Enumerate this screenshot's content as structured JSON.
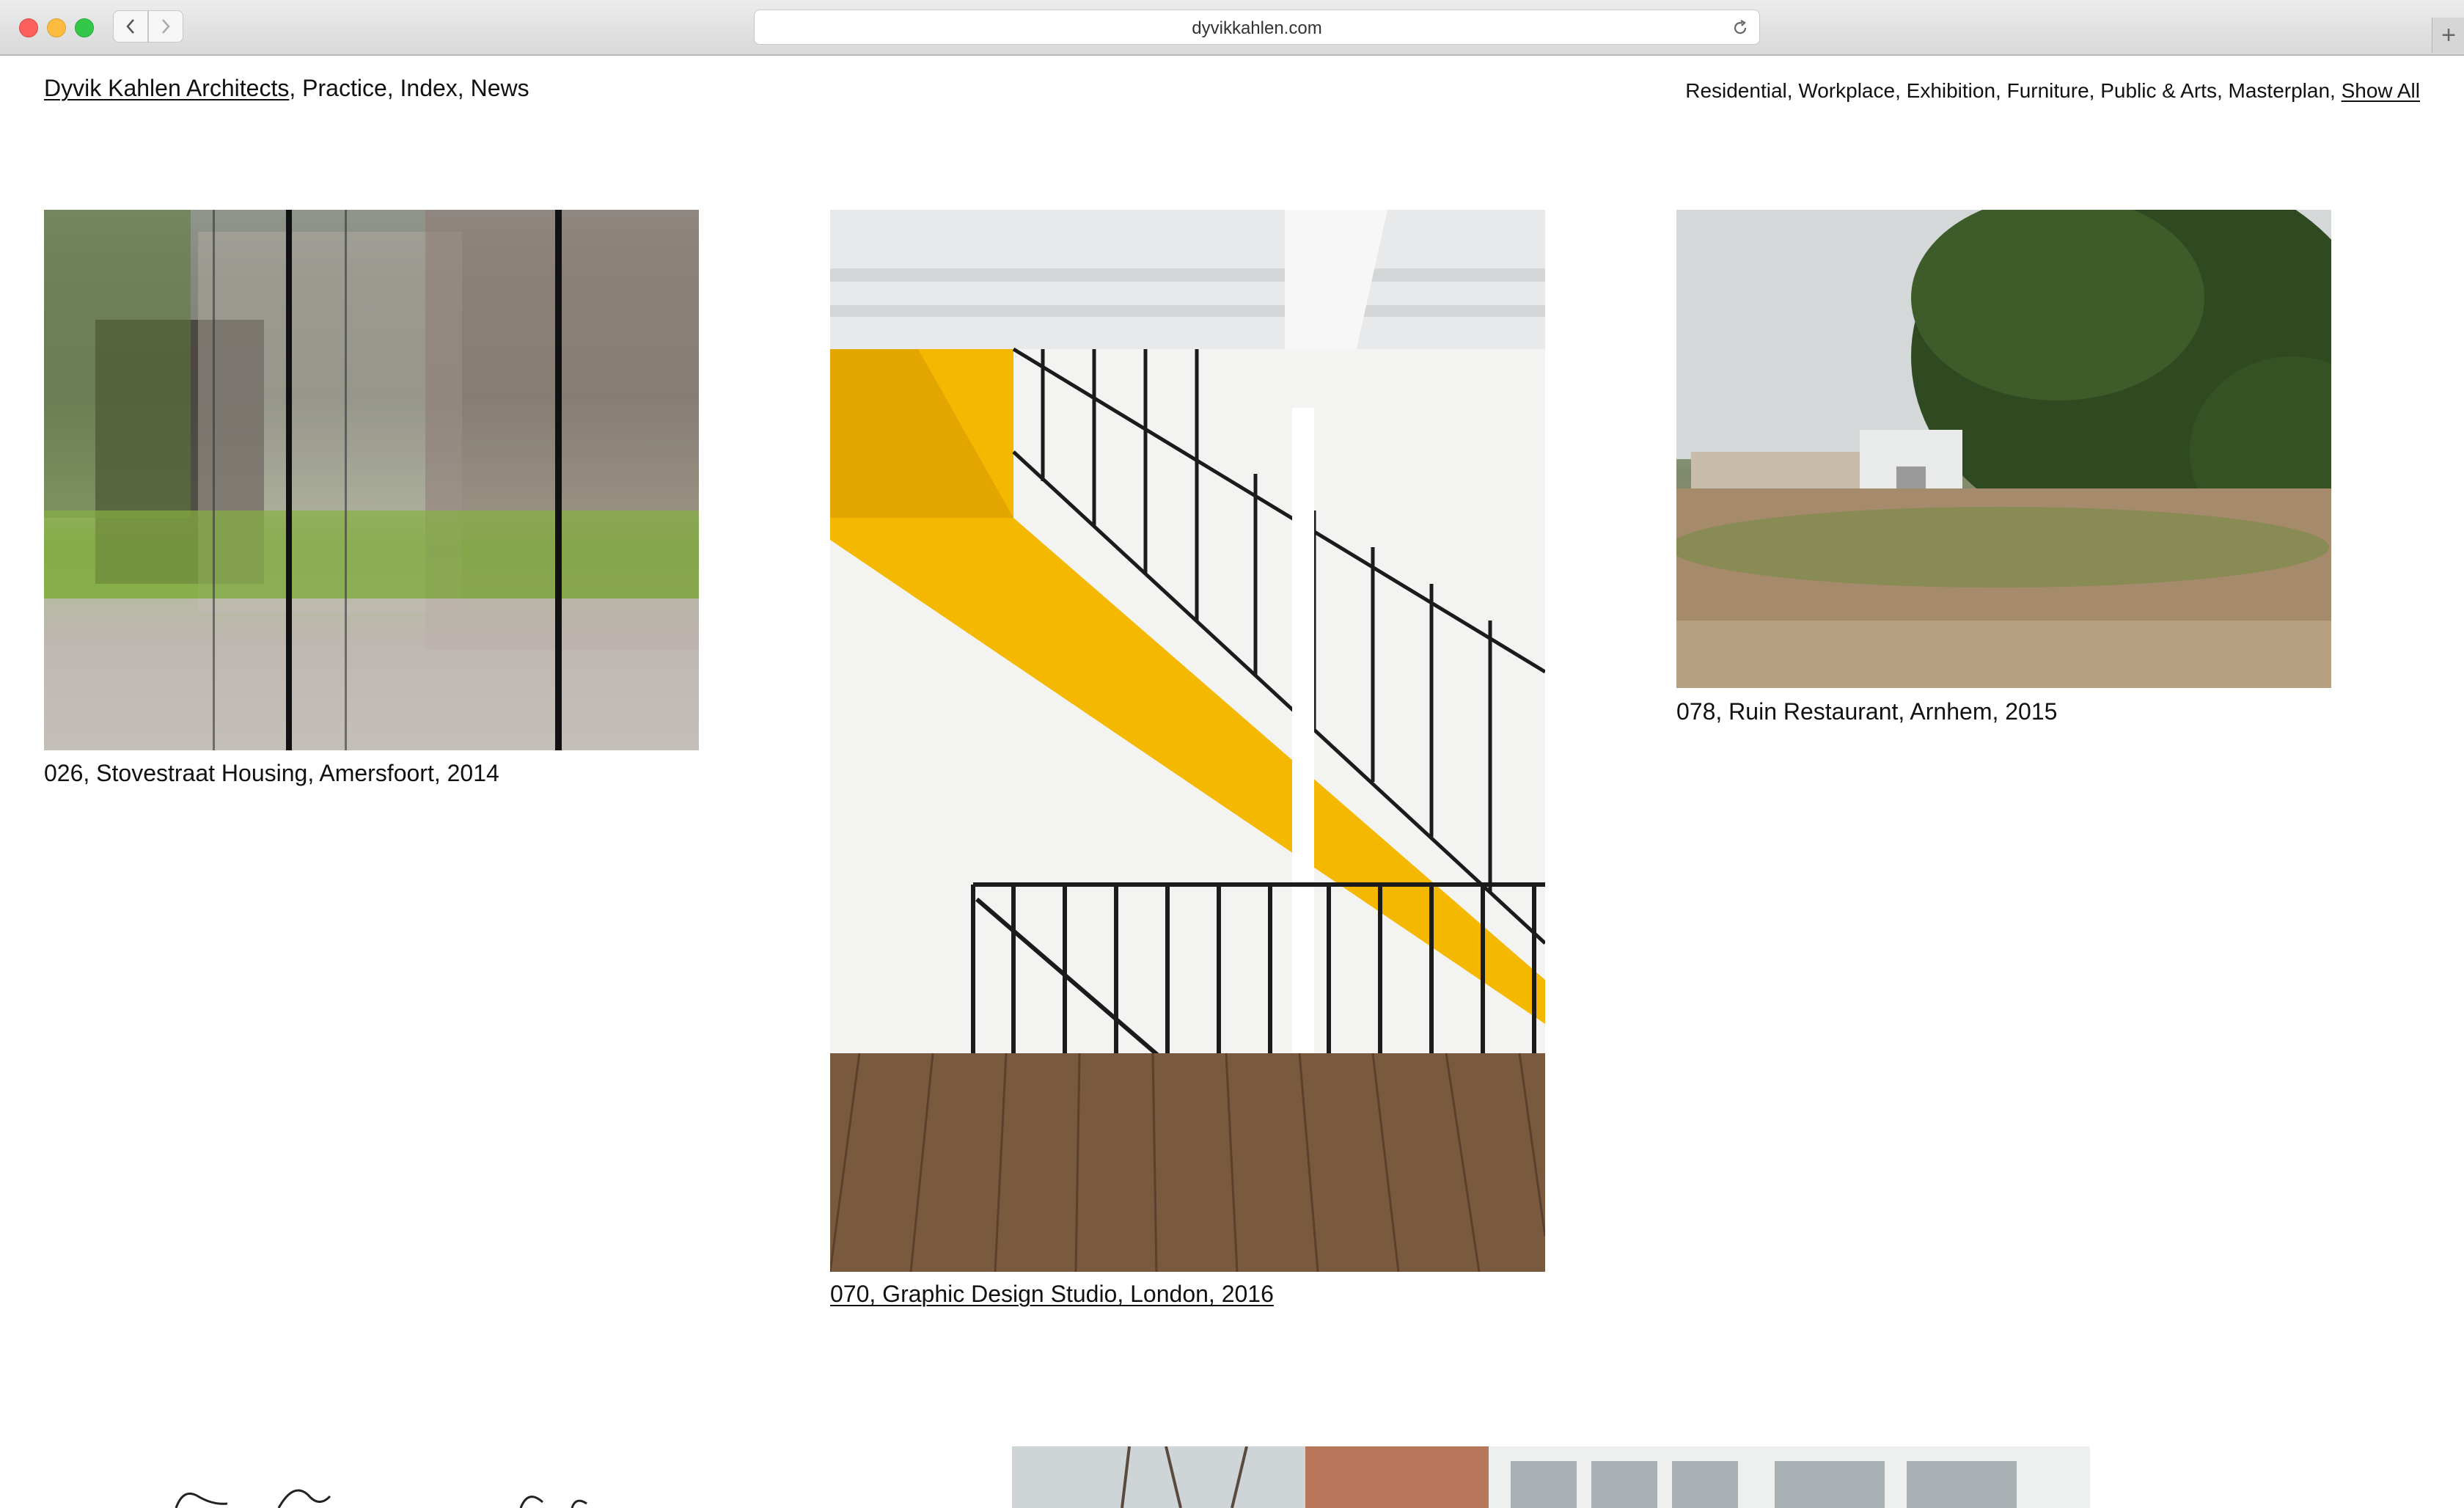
{
  "browser": {
    "url": "dyvikkahlen.com"
  },
  "site_nav": {
    "brand": "Dyvik Kahlen Architects",
    "items": [
      "Practice",
      "Index",
      "News"
    ]
  },
  "filters": {
    "items": [
      "Residential",
      "Workplace",
      "Exhibition",
      "Furniture",
      "Public & Arts",
      "Masterplan"
    ],
    "show_all": "Show All"
  },
  "projects": [
    {
      "caption": "026, Stovestraat Housing, Amersfoort, 2014"
    },
    {
      "caption": "070, Graphic Design Studio, London, 2016"
    },
    {
      "caption": "078, Ruin Restaurant, Arnhem, 2015"
    }
  ]
}
